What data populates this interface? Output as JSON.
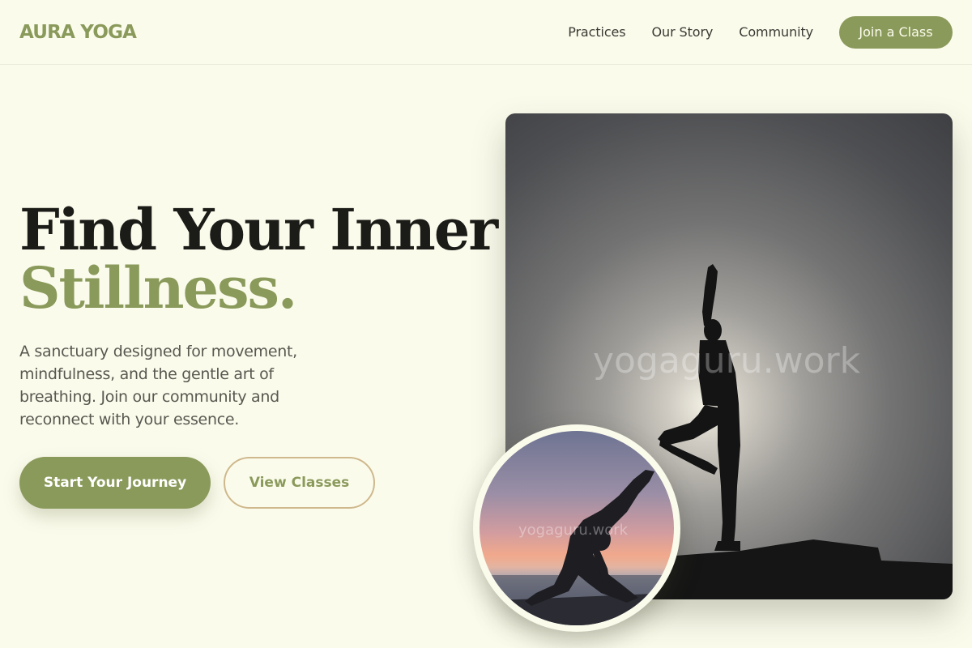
{
  "nav": {
    "brand": "AURA YOGA",
    "links": [
      {
        "label": "Practices"
      },
      {
        "label": "Our Story"
      },
      {
        "label": "Community"
      }
    ],
    "cta_label": "Join a Class"
  },
  "hero": {
    "title_line1": "Find Your Inner",
    "title_line2": "Stillness.",
    "description": "A sanctuary designed for movement, mindfulness, and the gentle art of breathing. Join our community and reconnect with your essence.",
    "primary_button": "Start Your Journey",
    "secondary_button": "View Classes"
  },
  "images": {
    "main_watermark": "yogaguru.work",
    "circle_watermark": "yogaguru.work"
  },
  "colors": {
    "background": "#fbfbec",
    "accent": "#8a9a5b",
    "secondary_border": "#cfb88c",
    "text_dark": "#1b1b17"
  }
}
